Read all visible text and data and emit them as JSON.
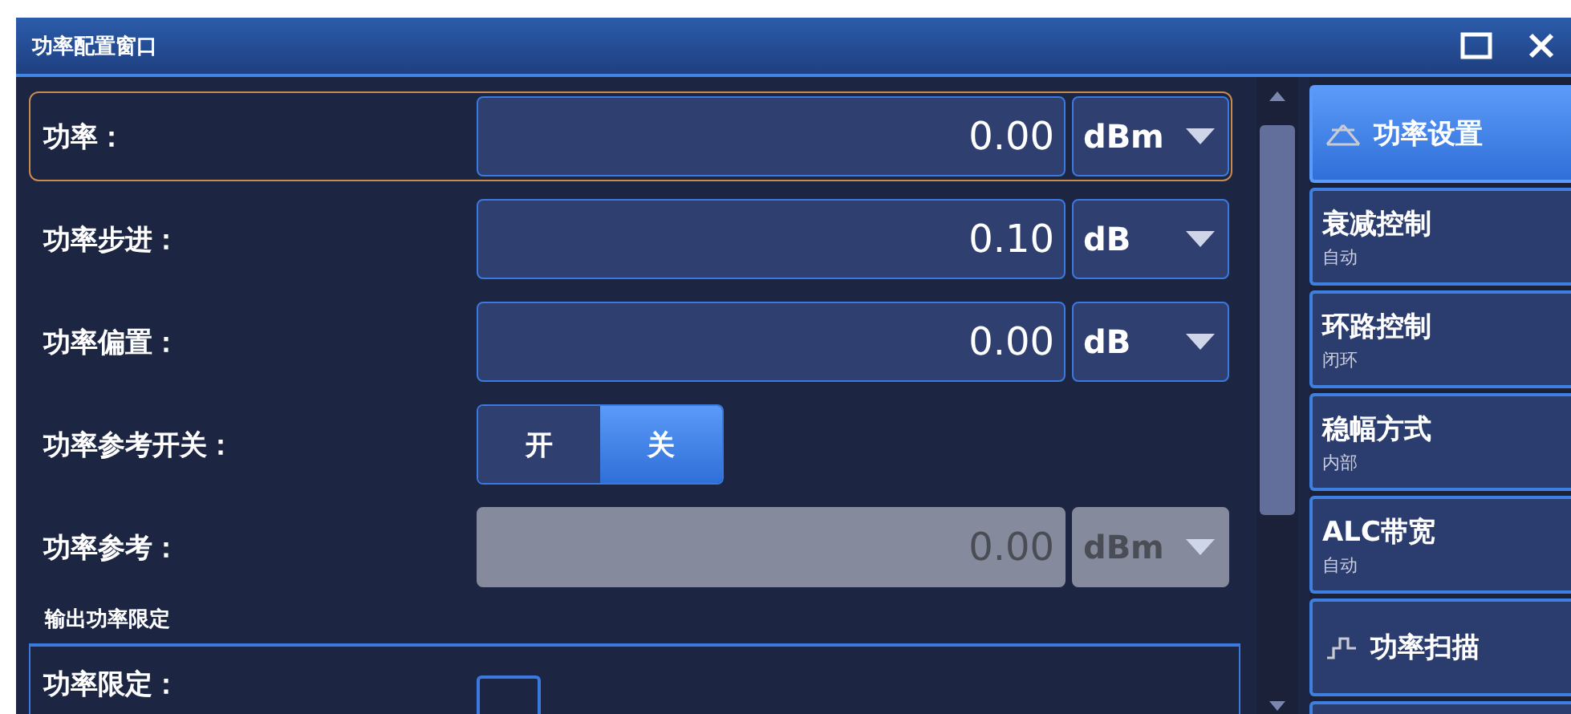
{
  "window": {
    "title": "功率配置窗口"
  },
  "rows": [
    {
      "kind": "input",
      "label": "功率：",
      "value": "0.00",
      "unit": "dBm",
      "focused": true,
      "disabled": false
    },
    {
      "kind": "input",
      "label": "功率步进：",
      "value": "0.10",
      "unit": "dB",
      "focused": false,
      "disabled": false
    },
    {
      "kind": "input",
      "label": "功率偏置：",
      "value": "0.00",
      "unit": "dB",
      "focused": false,
      "disabled": false
    },
    {
      "kind": "toggle",
      "label": "功率参考开关：",
      "options": [
        {
          "label": "开",
          "selected": false
        },
        {
          "label": "关",
          "selected": true
        }
      ]
    },
    {
      "kind": "input",
      "label": "功率参考：",
      "value": "0.00",
      "unit": "dBm",
      "focused": false,
      "disabled": true
    }
  ],
  "section": {
    "title": "输出功率限定",
    "rows": [
      {
        "kind": "checkbox",
        "label": "功率限定：",
        "checked": false
      }
    ]
  },
  "menu": [
    {
      "kind": "collapse-header",
      "label": "功率设置",
      "selected": true
    },
    {
      "kind": "item",
      "label": "衰减控制",
      "subtitle": "自动",
      "selected": false
    },
    {
      "kind": "item",
      "label": "环路控制",
      "subtitle": "闭环",
      "selected": false
    },
    {
      "kind": "item",
      "label": "稳幅方式",
      "subtitle": "内部",
      "selected": false
    },
    {
      "kind": "item",
      "label": "ALC带宽",
      "subtitle": "自动",
      "selected": false
    },
    {
      "kind": "step-header",
      "label": "功率扫描",
      "selected": false
    },
    {
      "kind": "blank",
      "selected": false
    }
  ]
}
